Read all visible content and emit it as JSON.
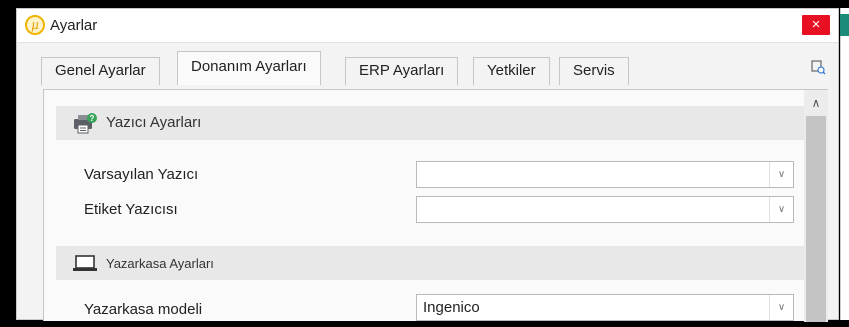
{
  "window": {
    "title": "Ayarlar",
    "app_icon_glyph": "μ",
    "close_glyph": "×",
    "close_color": "#e81123"
  },
  "tabs": [
    {
      "label": "Genel Ayarlar",
      "active": false
    },
    {
      "label": "Donanım Ayarları",
      "active": true
    },
    {
      "label": "ERP Ayarları",
      "active": false
    },
    {
      "label": "Yetkiler",
      "active": false
    },
    {
      "label": "Servis",
      "active": false
    }
  ],
  "groups": {
    "printer": {
      "title": "Yazıcı Ayarları",
      "icon": "printer-icon",
      "fields": [
        {
          "label": "Varsayılan Yazıcı",
          "value": ""
        },
        {
          "label": "Etiket Yazıcısı",
          "value": ""
        }
      ]
    },
    "cash_register": {
      "title": "Yazarkasa Ayarları",
      "icon": "laptop-icon",
      "fields": [
        {
          "label": "Yazarkasa modeli",
          "value": "Ingenico"
        }
      ]
    }
  },
  "icons": {
    "dropdown": "chevron-down-icon",
    "scroll_up": "chevron-up-icon",
    "pin": "pin-icon"
  }
}
